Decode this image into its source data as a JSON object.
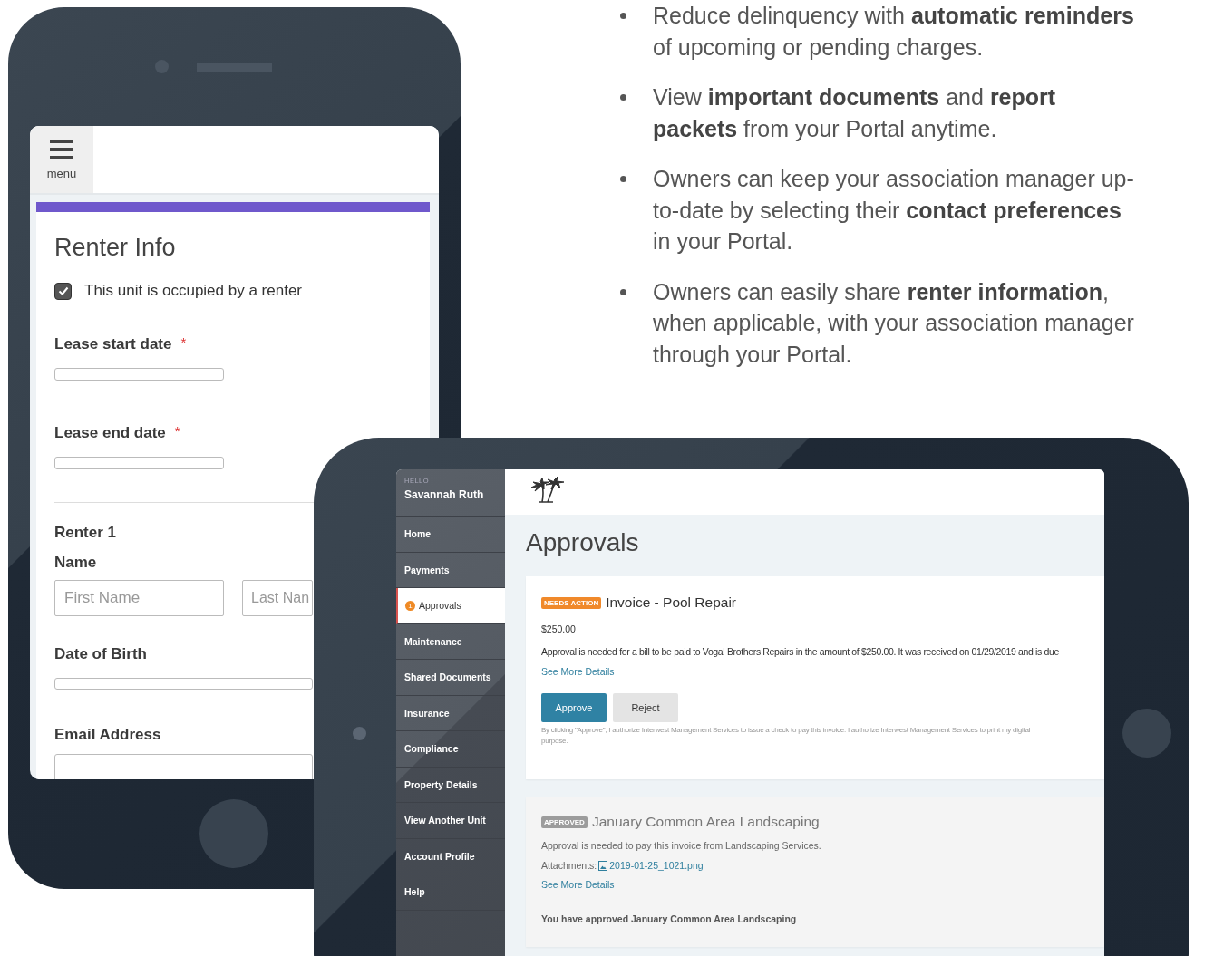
{
  "phone": {
    "menu_label": "menu",
    "form": {
      "title": "Renter Info",
      "checkbox": {
        "label": "This unit is occupied by a renter",
        "checked": true
      },
      "lease_fields": [
        {
          "label": "Lease start date",
          "required_mark": "*"
        },
        {
          "label": "Lease end date",
          "required_mark": "*"
        }
      ],
      "renter": {
        "heading": "Renter 1",
        "name_label": "Name",
        "first_placeholder": "First Name",
        "last_placeholder": "Last Nan"
      },
      "renter_fields": [
        {
          "label": "Date of Birth",
          "kind": "date"
        },
        {
          "label": "Email Address",
          "kind": "text"
        }
      ]
    }
  },
  "bullets": [
    "Reduce delinquency with **automatic reminders** of upcoming or pending charges.",
    "View **important documents** and **report packets** from your Portal anytime.",
    "Owners can keep your association manager up-to-date by selecting their **contact preferences** in your Portal.",
    "Owners can easily share **renter information**, when applicable, with your association manager through your Portal."
  ],
  "tablet": {
    "greeting": "HELLO",
    "user": "Savannah Ruth",
    "nav": [
      {
        "label": "Home",
        "selected": false
      },
      {
        "label": "Payments",
        "selected": false
      },
      {
        "label": "Approvals",
        "selected": true,
        "badge": "1"
      },
      {
        "label": "Maintenance",
        "selected": false
      },
      {
        "label": "Shared Documents",
        "selected": false
      },
      {
        "label": "Insurance",
        "selected": false
      },
      {
        "label": "Compliance",
        "selected": false
      },
      {
        "label": "Property Details",
        "selected": false
      },
      {
        "label": "View Another Unit",
        "selected": false
      },
      {
        "label": "Account Profile",
        "selected": false
      },
      {
        "label": "Help",
        "selected": false
      }
    ],
    "page_title": "Approvals",
    "approvals": [
      {
        "kind": "pending",
        "status": "NEEDS ACTION",
        "title": "Invoice - Pool Repair",
        "amount": "$250.00",
        "description": "Approval is needed for a bill to be paid to Vogal Brothers Repairs in the amount of $250.00. It was received on 01/29/2019 and is due",
        "link": "See More Details",
        "actions": [
          {
            "label": "Approve",
            "kind": "primary"
          },
          {
            "label": "Reject",
            "kind": "secondary"
          }
        ],
        "disclaimer": [
          "By clicking \"Approve\", I authorize Interwest Management Services to issue a check to pay this invoice. I authorize Interwest Management Services to print my digital",
          "purpose."
        ]
      },
      {
        "kind": "approved",
        "status": "APPROVED",
        "title": "January Common Area Landscaping",
        "description": "Approval is needed to pay this invoice from Landscaping Services.",
        "attachments_label": "Attachments:",
        "attachment": "2019-01-25_1021.png",
        "link": "See More Details",
        "note": "You have approved January Common Area Landscaping"
      }
    ]
  }
}
